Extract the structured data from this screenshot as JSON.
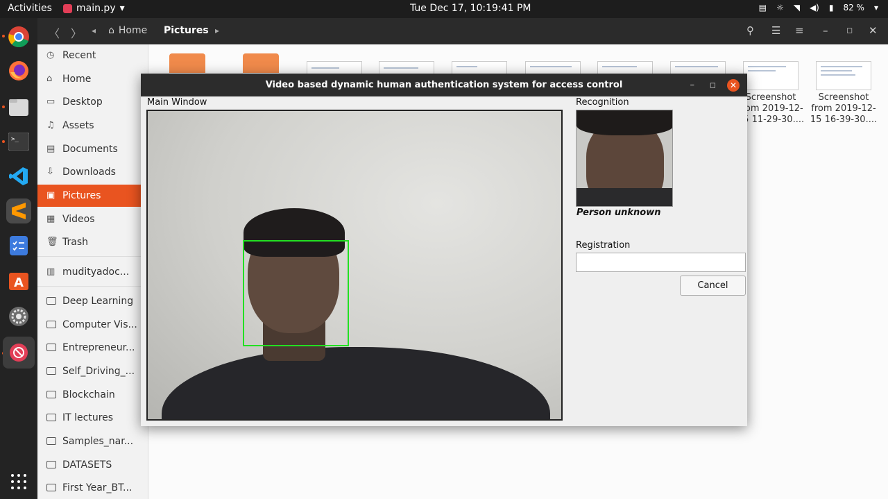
{
  "topbar": {
    "activities": "Activities",
    "app_name": "main.py",
    "clock": "Tue Dec 17, 10:19:41 PM",
    "battery": "82 %"
  },
  "dock": {
    "items": [
      "chrome-icon",
      "firefox-icon",
      "files-icon",
      "terminal-icon",
      "vscode-icon",
      "sublime-text-icon",
      "tasks-icon",
      "software-center-icon",
      "settings-icon",
      "python-app-icon"
    ]
  },
  "filemanager": {
    "breadcrumb": {
      "home": "Home",
      "current": "Pictures"
    },
    "sidebar": [
      {
        "label": "Recent",
        "icon": "clock-icon"
      },
      {
        "label": "Home",
        "icon": "home-icon"
      },
      {
        "label": "Desktop",
        "icon": "desktop-icon"
      },
      {
        "label": "Assets",
        "icon": "music-icon"
      },
      {
        "label": "Documents",
        "icon": "document-icon"
      },
      {
        "label": "Downloads",
        "icon": "download-icon"
      },
      {
        "label": "Pictures",
        "icon": "image-icon",
        "active": true
      },
      {
        "label": "Videos",
        "icon": "video-icon"
      },
      {
        "label": "Trash",
        "icon": "trash-icon"
      },
      {
        "label": "mudityadoc...",
        "icon": "drive-icon"
      },
      {
        "label": "Deep Learning",
        "icon": "folder-icon"
      },
      {
        "label": "Computer Vis...",
        "icon": "folder-icon"
      },
      {
        "label": "Entrepreneur...",
        "icon": "folder-icon"
      },
      {
        "label": "Self_Driving_...",
        "icon": "folder-icon"
      },
      {
        "label": "Blockchain",
        "icon": "folder-icon"
      },
      {
        "label": "IT lectures",
        "icon": "folder-icon"
      },
      {
        "label": "Samples_nar...",
        "icon": "folder-icon"
      },
      {
        "label": "DATASETS",
        "icon": "folder-icon"
      },
      {
        "label": "First Year_BT...",
        "icon": "folder-icon"
      }
    ],
    "files": [
      {
        "line1": "Screenshot",
        "line2": "from 2019-12-",
        "line3": "15 11-29-30...."
      },
      {
        "line1": "Screenshot",
        "line2": "from 2019-12-",
        "line3": "15 16-39-30...."
      }
    ]
  },
  "app": {
    "title": "Video based dynamic human authentication system for access control",
    "main_window_label": "Main Window",
    "recognition_label": "Recognition",
    "status": "Person unknown",
    "registration_label": "Registration",
    "registration_value": "",
    "cancel_label": "Cancel",
    "face_box_color": "#22e022"
  },
  "colors": {
    "accent": "#e95420",
    "topbar": "#1d1d1d",
    "dock": "#232323"
  }
}
